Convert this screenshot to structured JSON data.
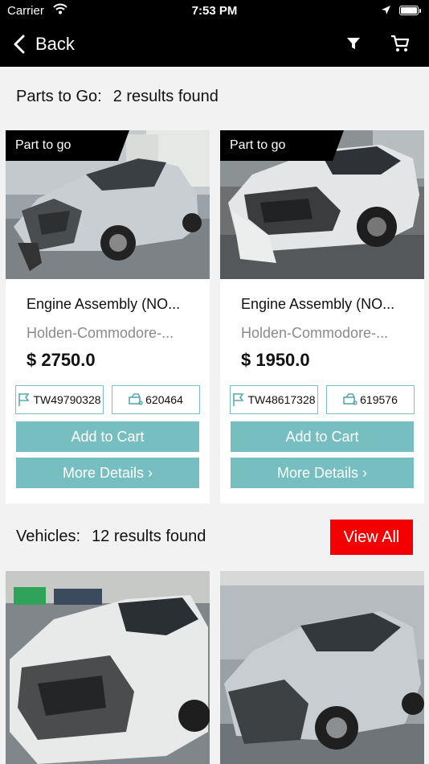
{
  "status_bar": {
    "carrier": "Carrier",
    "time": "7:53 PM"
  },
  "nav": {
    "back_label": "Back"
  },
  "parts_section": {
    "label": "Parts to Go:",
    "count": "2 results found"
  },
  "parts": [
    {
      "tag": "Part to go",
      "name": "Engine Assembly (NO...",
      "model": "Holden-Commodore-...",
      "price": "$ 2750.0",
      "stock_id": "TW49790328",
      "ref_id": "620464",
      "add_label": "Add to Cart",
      "details_label": "More Details ›"
    },
    {
      "tag": "Part to go",
      "name": "Engine Assembly (NO...",
      "model": "Holden-Commodore-...",
      "price": "$ 1950.0",
      "stock_id": "TW48617328",
      "ref_id": "619576",
      "add_label": "Add to Cart",
      "details_label": "More Details ›"
    }
  ],
  "vehicles_section": {
    "label": "Vehicles:",
    "count": "12 results found",
    "view_all": "View All"
  },
  "colors": {
    "accent": "#77bec1",
    "red": "#f40000",
    "bar": "#000000"
  }
}
